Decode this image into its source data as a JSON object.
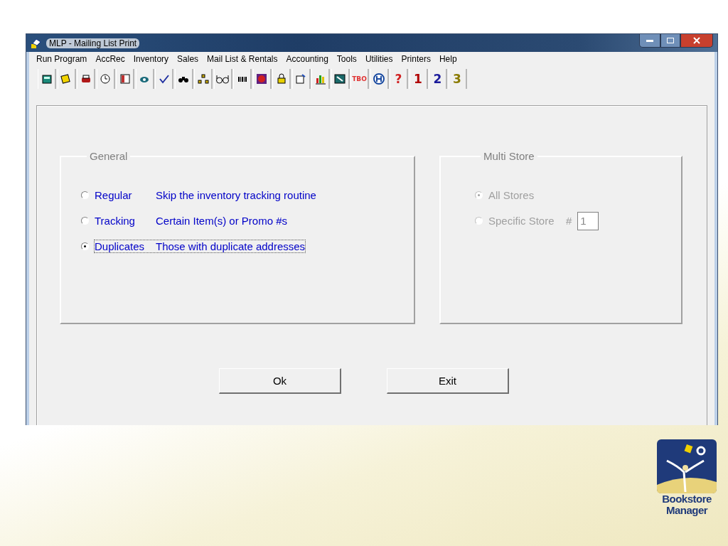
{
  "window": {
    "title": "MLP - Mailing List Print"
  },
  "menu": [
    "Run Program",
    "AccRec",
    "Inventory",
    "Sales",
    "Mail List & Rentals",
    "Accounting",
    "Tools",
    "Utilities",
    "Printers",
    "Help"
  ],
  "toolbar_labels": [
    {
      "text": "TBO",
      "color": "#e03030"
    },
    {
      "text": "?",
      "color": "#d02020"
    },
    {
      "text": "1",
      "color": "#b00000"
    },
    {
      "text": "2",
      "color": "#1a1a9a"
    },
    {
      "text": "3",
      "color": "#8a7a00"
    }
  ],
  "general": {
    "title": "General",
    "options": [
      {
        "label": "Regular",
        "description": "Skip the inventory tracking routine",
        "selected": false,
        "focused": false
      },
      {
        "label": "Tracking",
        "description": "Certain Item(s) or Promo #s",
        "selected": false,
        "focused": false
      },
      {
        "label": "Duplicates",
        "description": "Those with duplicate addresses",
        "selected": true,
        "focused": true
      }
    ]
  },
  "multi_store": {
    "title": "Multi Store",
    "disabled": true,
    "options": [
      {
        "label": "All Stores",
        "selected": true
      },
      {
        "label": "Specific Store",
        "selected": false
      }
    ],
    "store_number_label": "#",
    "store_number": "1"
  },
  "buttons": [
    "Ok",
    "Exit"
  ],
  "logo": {
    "line_1": "Bookstore",
    "line_2": "Manager"
  }
}
